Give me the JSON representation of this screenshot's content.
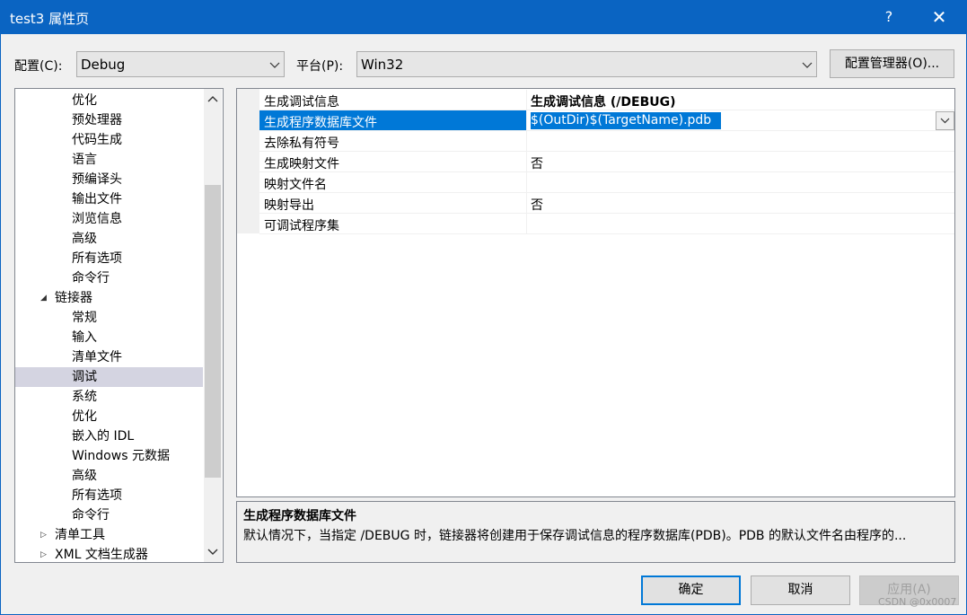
{
  "window": {
    "title": "test3 属性页",
    "help_label": "?",
    "close_label": "✕"
  },
  "config": {
    "config_label": "配置(C):",
    "config_value": "Debug",
    "platform_label": "平台(P):",
    "platform_value": "Win32",
    "manager_button": "配置管理器(O)..."
  },
  "tree": {
    "items": [
      {
        "label": "优化"
      },
      {
        "label": "预处理器"
      },
      {
        "label": "代码生成"
      },
      {
        "label": "语言"
      },
      {
        "label": "预编译头"
      },
      {
        "label": "输出文件"
      },
      {
        "label": "浏览信息"
      },
      {
        "label": "高级"
      },
      {
        "label": "所有选项"
      },
      {
        "label": "命令行"
      },
      {
        "label": "链接器",
        "toggle": "◢"
      },
      {
        "label": "常规"
      },
      {
        "label": "输入"
      },
      {
        "label": "清单文件"
      },
      {
        "label": "调试"
      },
      {
        "label": "系统"
      },
      {
        "label": "优化"
      },
      {
        "label": "嵌入的 IDL"
      },
      {
        "label": "Windows 元数据"
      },
      {
        "label": "高级"
      },
      {
        "label": "所有选项"
      },
      {
        "label": "命令行"
      },
      {
        "label": "清单工具",
        "toggle": "▷"
      },
      {
        "label": "XML 文档生成器",
        "toggle": "▷"
      }
    ]
  },
  "grid": {
    "rows": [
      {
        "name": "生成调试信息",
        "value": "生成调试信息 (/DEBUG)"
      },
      {
        "name": "生成程序数据库文件",
        "value": "$(OutDir)$(TargetName).pdb"
      },
      {
        "name": "去除私有符号",
        "value": ""
      },
      {
        "name": "生成映射文件",
        "value": "否"
      },
      {
        "name": "映射文件名",
        "value": ""
      },
      {
        "name": "映射导出",
        "value": "否"
      },
      {
        "name": "可调试程序集",
        "value": ""
      }
    ]
  },
  "description": {
    "title": "生成程序数据库文件",
    "text": "默认情况下，当指定 /DEBUG 时，链接器将创建用于保存调试信息的程序数据库(PDB)。PDB 的默认文件名由程序的..."
  },
  "buttons": {
    "ok": "确定",
    "cancel": "取消",
    "apply": "应用(A)"
  },
  "watermark": "CSDN @0x0007"
}
